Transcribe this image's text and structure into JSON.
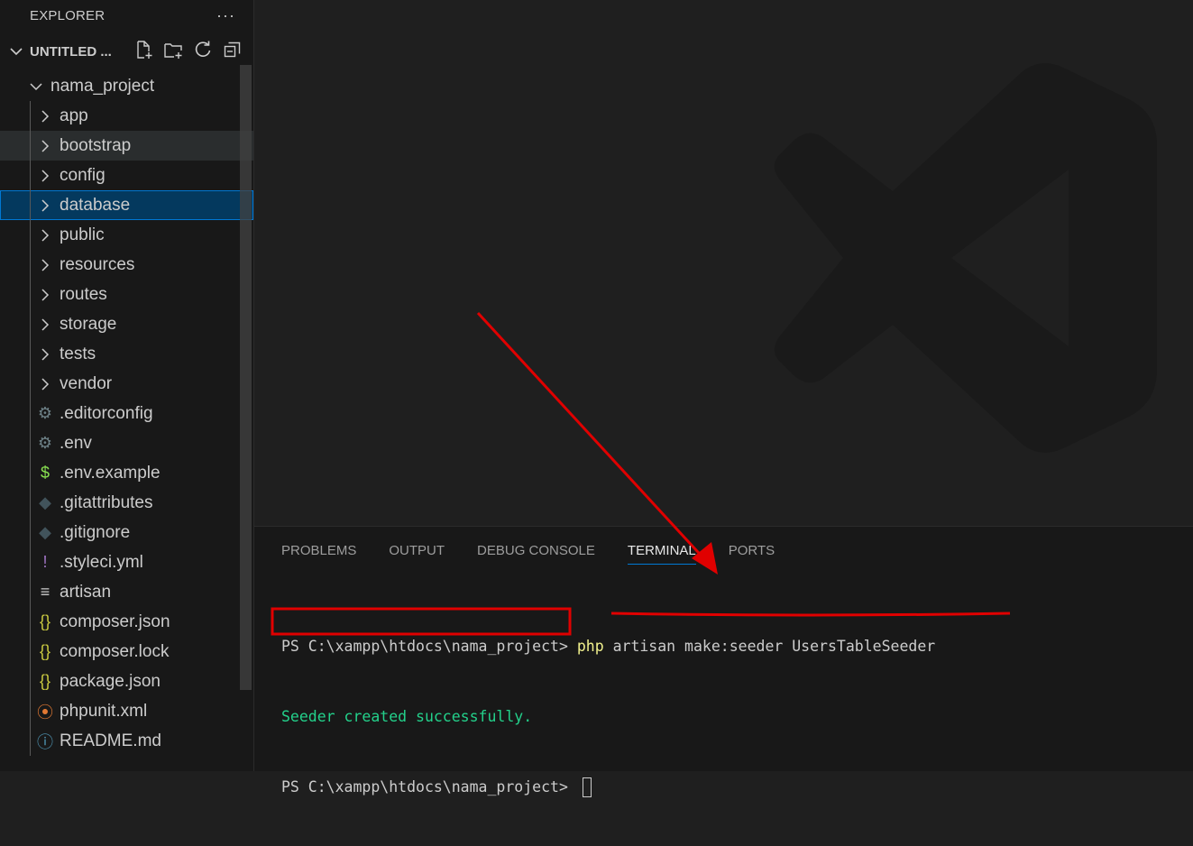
{
  "sidebar": {
    "title": "EXPLORER",
    "more_glyph": "···",
    "workspace": "UNTITLED ...",
    "actions": [
      "new-file-icon",
      "new-folder-icon",
      "refresh-icon",
      "collapse-all-icon"
    ],
    "project": "nama_project",
    "folders": [
      {
        "label": "app"
      },
      {
        "label": "bootstrap"
      },
      {
        "label": "config"
      },
      {
        "label": "database"
      },
      {
        "label": "public"
      },
      {
        "label": "resources"
      },
      {
        "label": "routes"
      },
      {
        "label": "storage"
      },
      {
        "label": "tests"
      },
      {
        "label": "vendor"
      }
    ],
    "files": [
      {
        "label": ".editorconfig",
        "icon": "gear-icon",
        "glyph": "⚙",
        "color": "#6d8086"
      },
      {
        "label": ".env",
        "icon": "gear-icon",
        "glyph": "⚙",
        "color": "#6d8086"
      },
      {
        "label": ".env.example",
        "icon": "dollar-icon",
        "glyph": "$",
        "color": "#89e051"
      },
      {
        "label": ".gitattributes",
        "icon": "git-icon",
        "glyph": "◆",
        "color": "#41535b"
      },
      {
        "label": ".gitignore",
        "icon": "git-icon",
        "glyph": "◆",
        "color": "#41535b"
      },
      {
        "label": ".styleci.yml",
        "icon": "yaml-icon",
        "glyph": "!",
        "color": "#a074c4"
      },
      {
        "label": "artisan",
        "icon": "text-lines-icon",
        "glyph": "≡",
        "color": "#cccccc"
      },
      {
        "label": "composer.json",
        "icon": "json-braces-icon",
        "glyph": "{}",
        "color": "#cbcb41"
      },
      {
        "label": "composer.lock",
        "icon": "json-braces-icon",
        "glyph": "{}",
        "color": "#cbcb41"
      },
      {
        "label": "package.json",
        "icon": "json-braces-icon",
        "glyph": "{}",
        "color": "#cbcb41"
      },
      {
        "label": "phpunit.xml",
        "icon": "rss-icon",
        "glyph": "⦿",
        "color": "#e37933"
      },
      {
        "label": "README.md",
        "icon": "info-icon",
        "glyph": "ⓘ",
        "color": "#519aba"
      }
    ],
    "hover_index": 1,
    "selected_index": 3
  },
  "panel": {
    "tabs": [
      "PROBLEMS",
      "OUTPUT",
      "DEBUG CONSOLE",
      "TERMINAL",
      "PORTS"
    ],
    "active_tab": "TERMINAL",
    "terminal": {
      "prompt": "PS C:\\xampp\\htdocs\\nama_project> ",
      "command": "php",
      "args": " artisan make:seeder UsersTableSeeder",
      "output": "Seeder created successfully.",
      "prompt2": "PS C:\\xampp\\htdocs\\nama_project> "
    }
  },
  "colors": {
    "accent": "#0078d4",
    "success": "#23d18b",
    "command": "#f1f18d",
    "annotation": "#e00000"
  }
}
